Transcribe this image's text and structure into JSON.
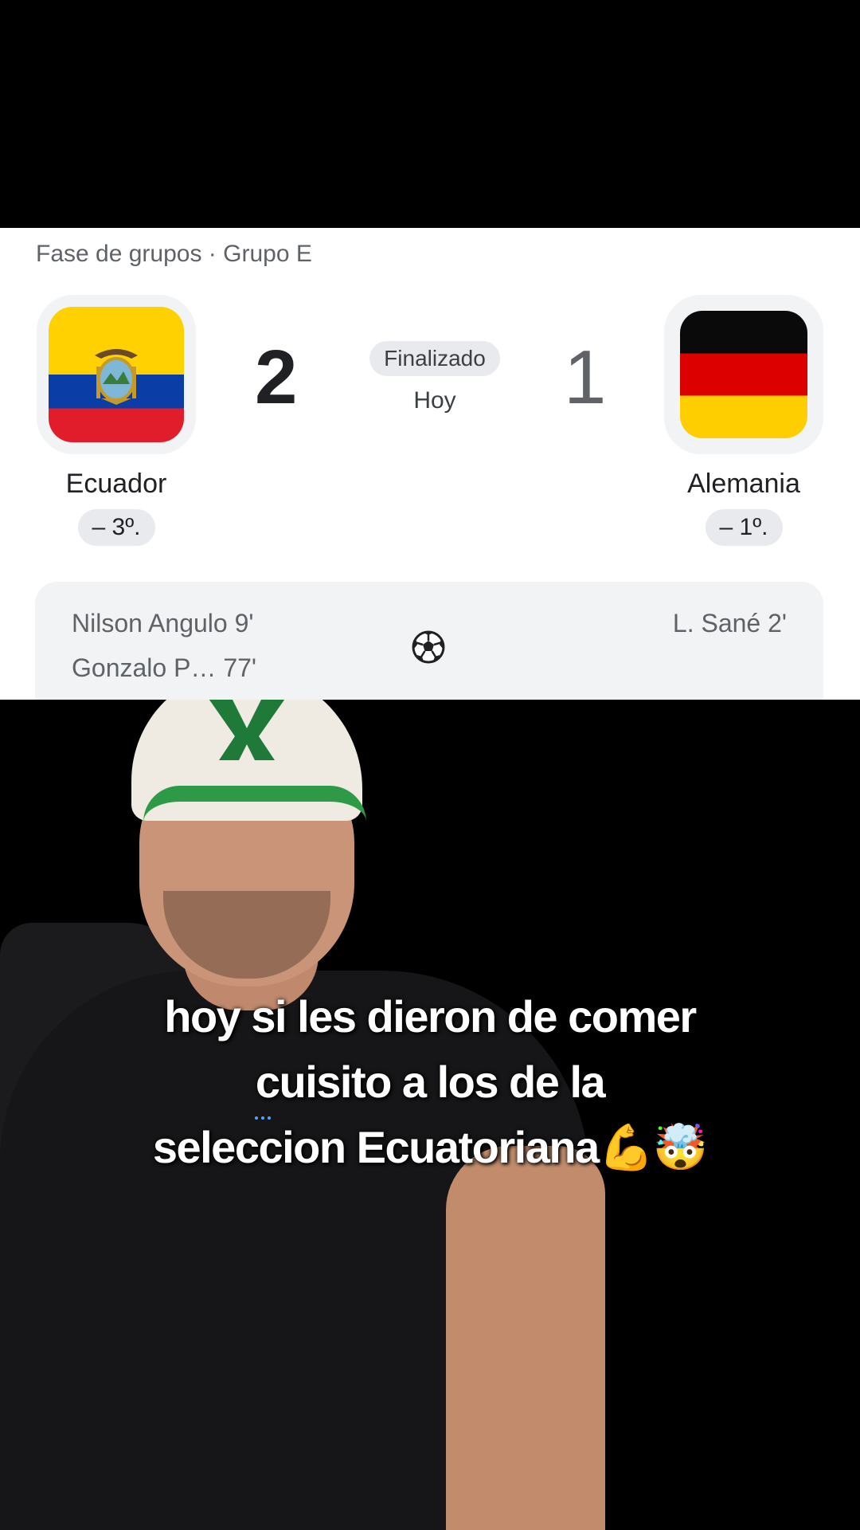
{
  "match": {
    "breadcrumb": "Fase de grupos · Grupo E",
    "home": {
      "name": "Ecuador",
      "score": "2",
      "rank": "– 3º.",
      "flag_colors": [
        "#ffd100",
        "#0a3da6",
        "#e21d2b"
      ],
      "scorers": [
        "Nilson Angulo 9'",
        "Gonzalo P… 77'"
      ]
    },
    "away": {
      "name": "Alemania",
      "score": "1",
      "rank": "– 1º.",
      "flag_colors": [
        "#0a0a0a",
        "#dd0000",
        "#ffce00"
      ],
      "scorers": [
        "L. Sané 2'"
      ]
    },
    "status": "Finalizado",
    "date": "Hoy",
    "scorers_icon": "soccer-ball-icon"
  },
  "caption": {
    "line1": "hoy si les dieron de comer",
    "line2": "cuisito a los de la",
    "line3": "seleccion Ecuatoriana💪🤯"
  }
}
